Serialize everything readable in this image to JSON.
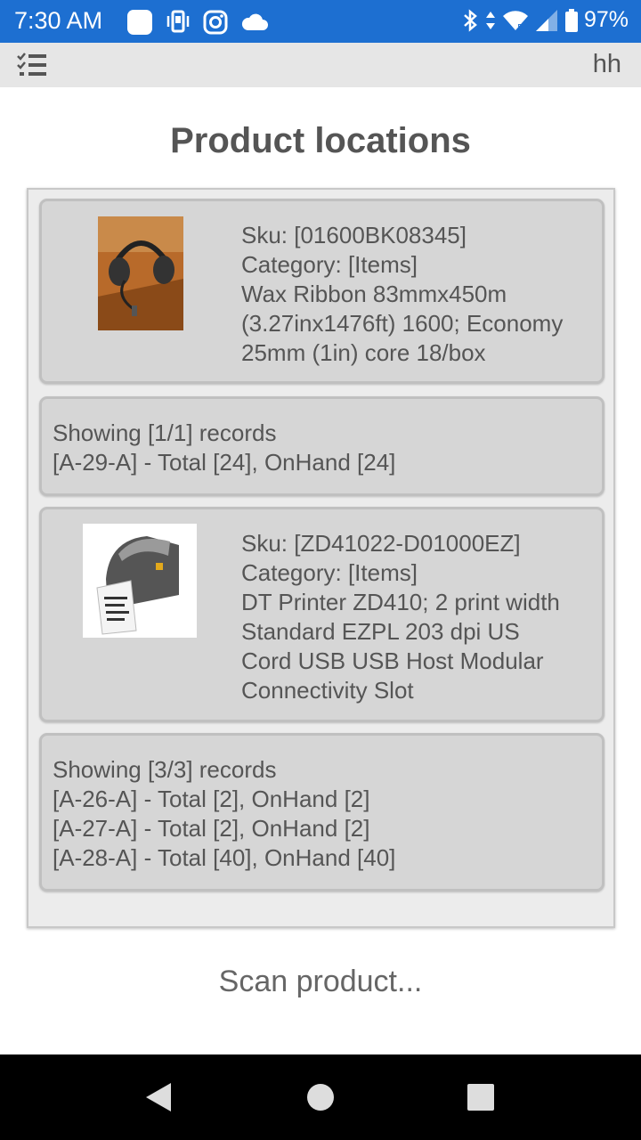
{
  "status_bar": {
    "time": "7:30 AM",
    "battery": "97%",
    "icons": [
      "app-icon",
      "phone-vibrate-icon",
      "instagram-icon",
      "cloud-icon",
      "bluetooth-icon",
      "data-arrows-icon",
      "wifi-icon",
      "signal-icon",
      "battery-icon"
    ]
  },
  "app_bar": {
    "menu_icon": "checklist-menu-icon",
    "user": "hh"
  },
  "page": {
    "title": "Product locations"
  },
  "products": [
    {
      "sku": "Sku: [01600BK08345]",
      "category": "Category: [Items]",
      "description_lines": [
        "Wax Ribbon 83mmx450m",
        "(3.27inx1476ft) 1600; Economy",
        "25mm (1in) core 18/box"
      ],
      "image": "headset-thumbnail",
      "records": {
        "summary": "Showing [1/1] records",
        "locations": [
          "[A-29-A] - Total [24], OnHand [24]"
        ]
      }
    },
    {
      "sku": "Sku: [ZD41022-D01000EZ]",
      "category": "Category: [Items]",
      "description_lines": [
        "DT Printer ZD410; 2 print width",
        "Standard EZPL 203 dpi US",
        "Cord USB USB Host Modular",
        "Connectivity Slot"
      ],
      "image": "label-printer-thumbnail",
      "records": {
        "summary": "Showing [3/3] records",
        "locations": [
          "[A-26-A] - Total [2], OnHand [2]",
          "[A-27-A] - Total [2], OnHand [2]",
          "[A-28-A] - Total [40], OnHand [40]"
        ]
      }
    }
  ],
  "scan": {
    "placeholder": "Scan product..."
  },
  "nav": {
    "buttons": [
      "back-icon",
      "home-icon",
      "recents-icon"
    ]
  }
}
